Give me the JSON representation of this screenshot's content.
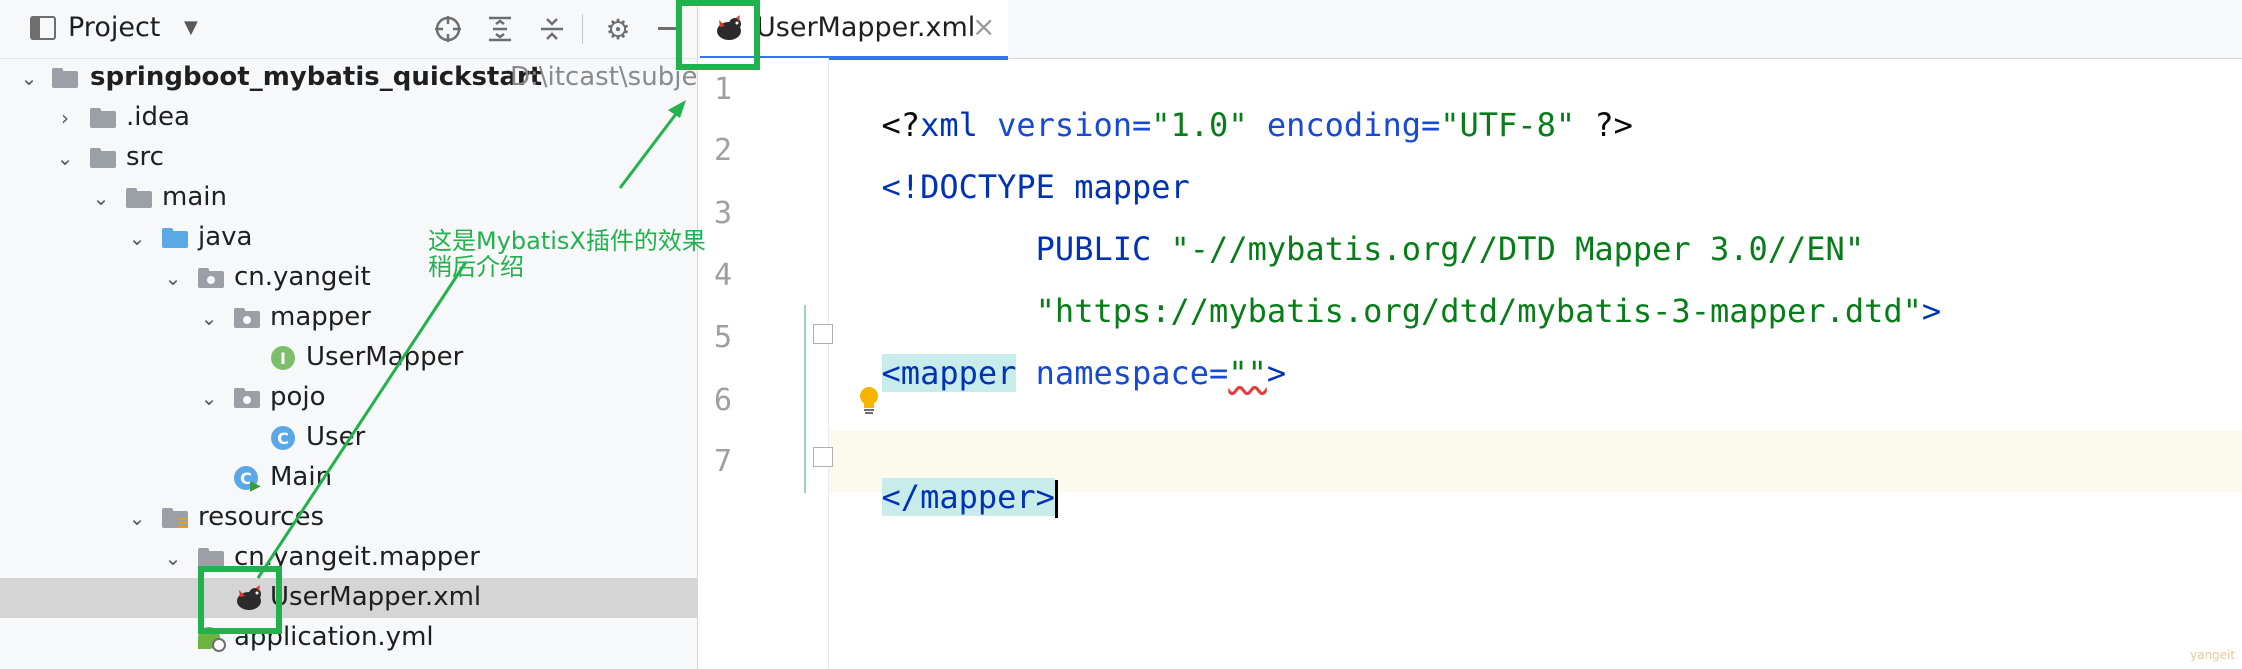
{
  "project_panel": {
    "title": "Project",
    "tree": [
      {
        "label": "springboot_mybatis_quickstart",
        "hint": "D:\\itcast\\subjec",
        "bold": true
      },
      {
        "label": ".idea"
      },
      {
        "label": "src"
      },
      {
        "label": "main"
      },
      {
        "label": "java"
      },
      {
        "label": "cn.yangeit"
      },
      {
        "label": "mapper"
      },
      {
        "label": "UserMapper"
      },
      {
        "label": "pojo"
      },
      {
        "label": "User"
      },
      {
        "label": "Main"
      },
      {
        "label": "resources"
      },
      {
        "label": "cn.yangeit.mapper"
      },
      {
        "label": "UserMapper.xml"
      },
      {
        "label": "application.yml"
      }
    ]
  },
  "editor": {
    "tab_label": "UserMapper.xml",
    "tab_close": "×",
    "line_numbers": [
      "1",
      "2",
      "3",
      "4",
      "5",
      "6",
      "7"
    ],
    "lines": {
      "l1": {
        "a": "<?",
        "b": "xml",
        "c": " version=",
        "d": "\"1.0\"",
        "e": " encoding=",
        "f": "\"UTF-8\"",
        "g": " ?>"
      },
      "l2": {
        "a": "<!",
        "b": "DOCTYPE mapper"
      },
      "l3": {
        "a": "        PUBLIC ",
        "b": "\"-//mybatis.org//DTD Mapper 3.0//EN\""
      },
      "l4": {
        "a": "        \"https://mybatis.org/dtd/mybatis-3-mapper.dtd\"",
        "b": ">"
      },
      "l5": {
        "a": "<",
        "b": "mapper",
        "c": " namespace=",
        "d": "\"\"",
        "e": ">"
      },
      "l7": {
        "a": "</",
        "b": "mapper",
        "c": ">"
      }
    }
  },
  "annotation": {
    "line1": "这是MybatisX插件的效果",
    "line2": "稍后介绍"
  },
  "watermark": "yangeit",
  "colors": {
    "annotation_green": "#22b14c",
    "tab_underline": "#3574f0",
    "tag_highlight": "#c8ecec",
    "caret_line": "#fcfaed"
  }
}
